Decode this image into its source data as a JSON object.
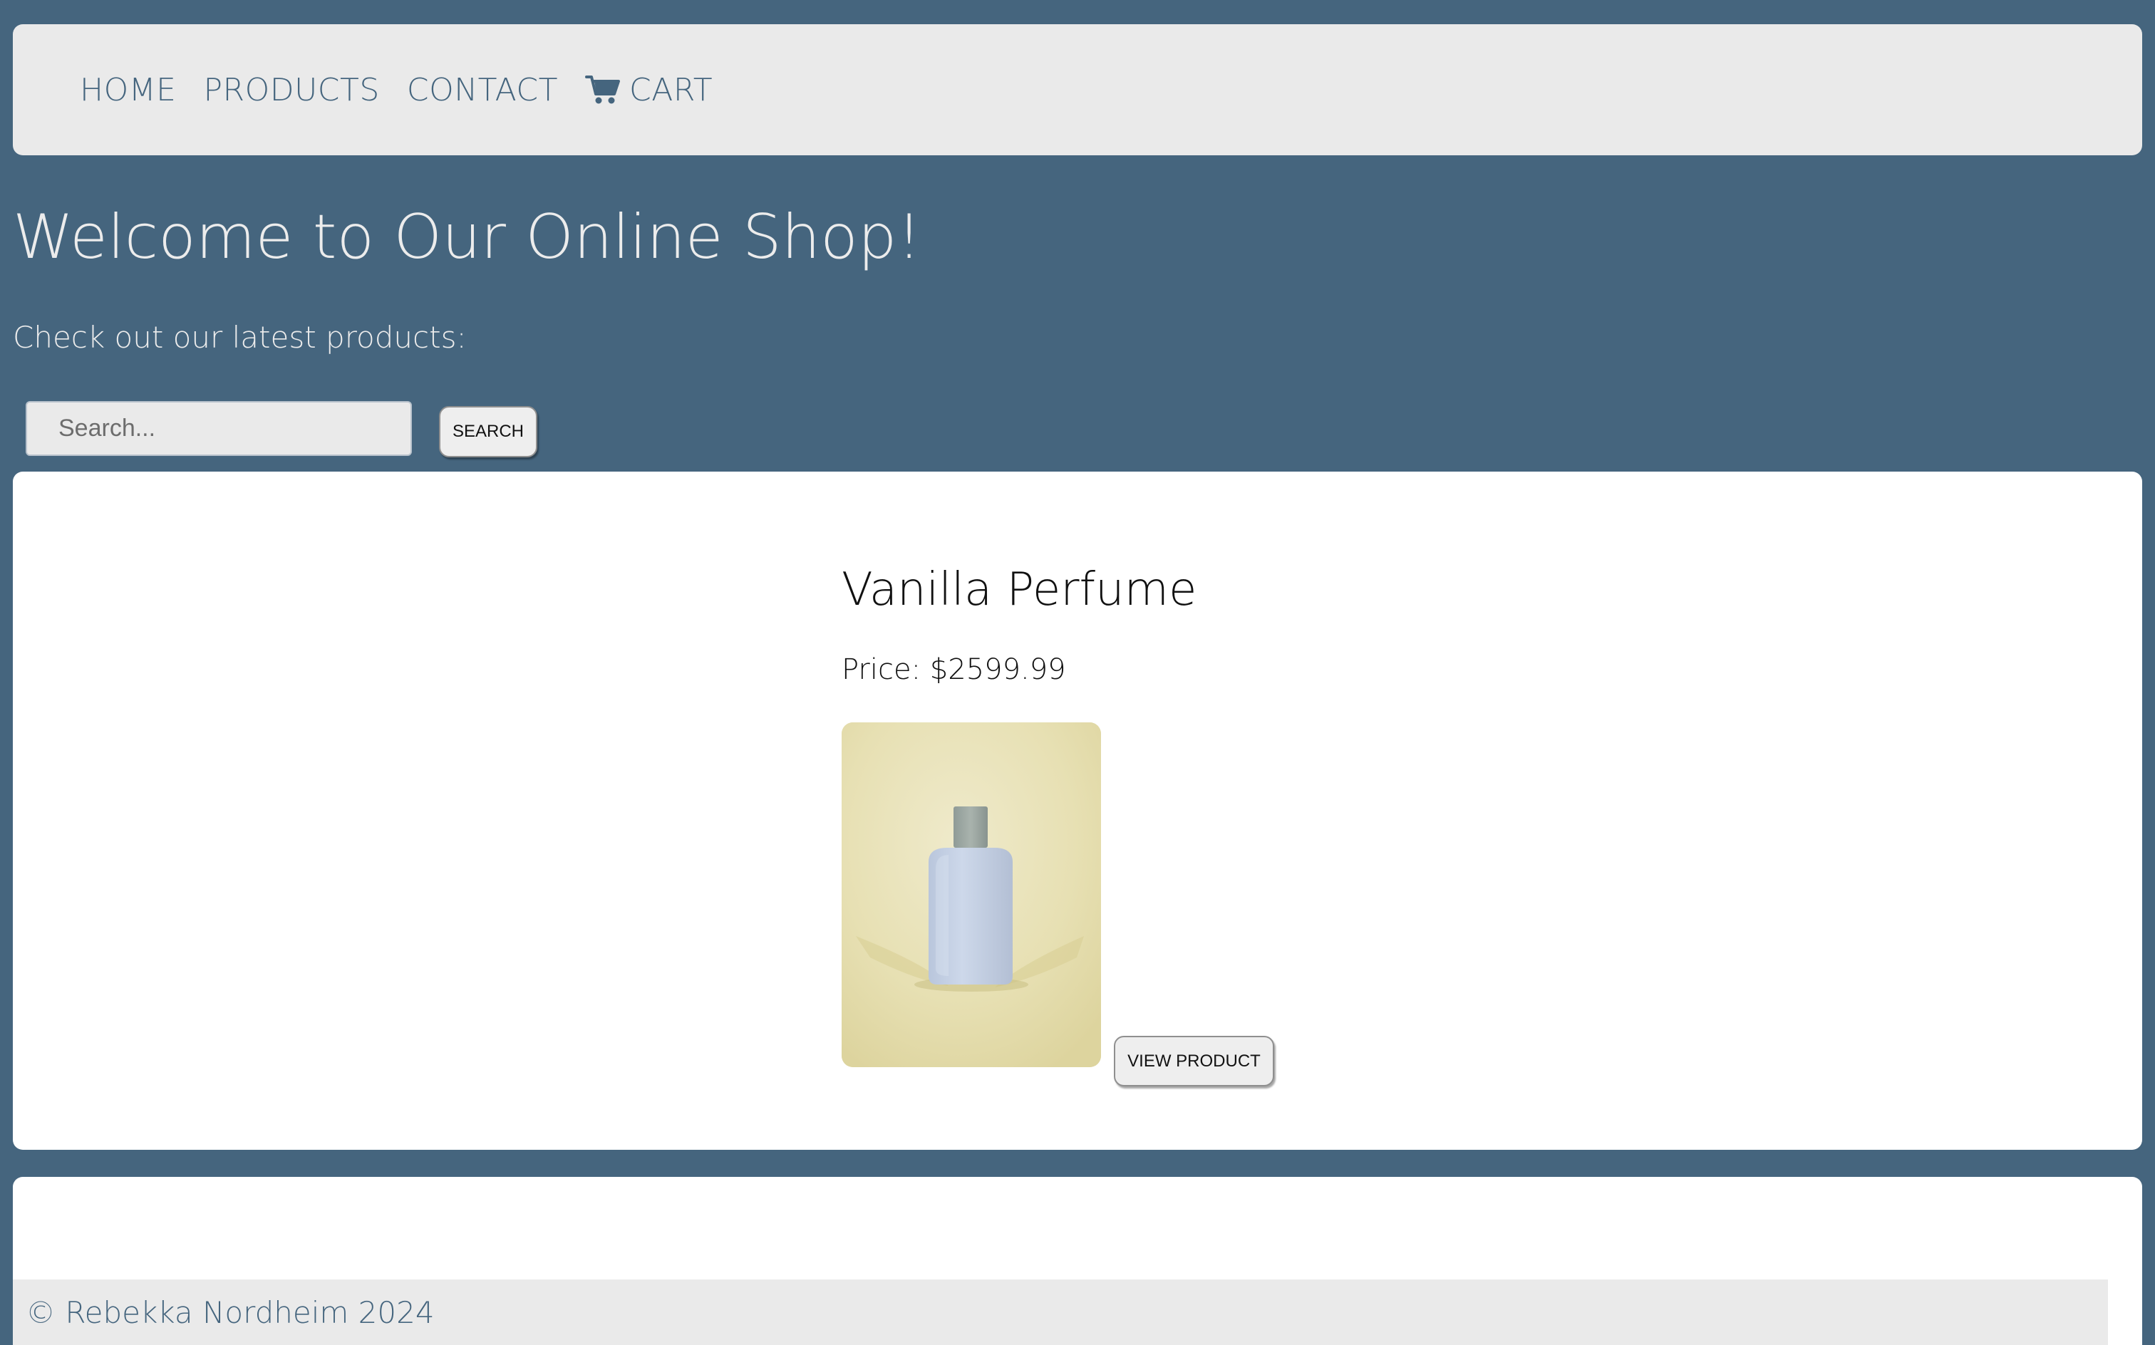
{
  "nav": {
    "items": [
      {
        "label": "HOME"
      },
      {
        "label": "PRODUCTS"
      },
      {
        "label": "CONTACT"
      },
      {
        "label": "CART",
        "icon": "cart-icon"
      }
    ]
  },
  "hero": {
    "title": "Welcome to Our Online Shop!",
    "subtitle": "Check out our latest products:"
  },
  "search": {
    "placeholder": "Search...",
    "value": "",
    "button_label": "SEARCH"
  },
  "product": {
    "name": "Vanilla Perfume",
    "price": "Price: $2599.99",
    "image_alt": "perfume-bottle-image",
    "button_label": "VIEW PRODUCT"
  },
  "footer": {
    "text": "© Rebekka Nordheim 2024"
  },
  "colors": {
    "background": "#45657e",
    "nav_background": "#eaeaea",
    "card_background": "#ffffff",
    "text_light": "#ececec",
    "accent_text": "#45657e"
  }
}
